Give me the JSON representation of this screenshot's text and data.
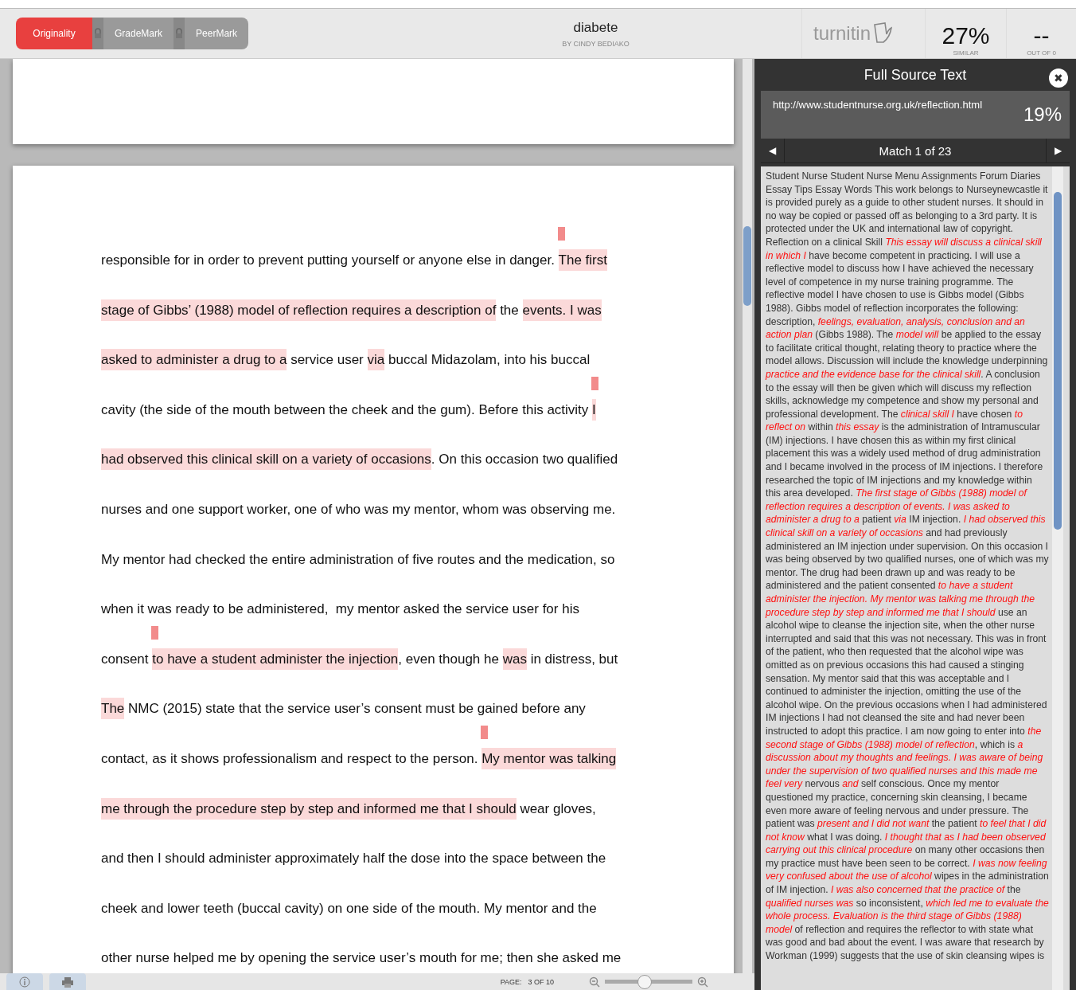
{
  "tabs": [
    {
      "label": "Originality",
      "selected": true,
      "locked": false
    },
    {
      "label": "GradeMark",
      "selected": false,
      "locked": true
    },
    {
      "label": "PeerMark",
      "selected": false,
      "locked": true
    }
  ],
  "document": {
    "title": "diabete",
    "author": "BY CINDY BEDIAKO"
  },
  "brand": "turnitin",
  "similarity": {
    "value": "27%",
    "label": "SIMILAR"
  },
  "grade": {
    "value": "--",
    "label": "OUT OF 0"
  },
  "essay_lines": [
    [
      {
        "text": "responsible for in order to prevent putting yourself or anyone else in danger. ",
        "match": false,
        "marker": false
      },
      {
        "text": "The first",
        "match": true,
        "marker": true
      }
    ],
    [
      {
        "text": "stage of Gibbs’ (1988) model of reflection requires a description of",
        "match": true,
        "marker": false
      },
      {
        "text": " the ",
        "match": false,
        "marker": false
      },
      {
        "text": "events. I was",
        "match": true,
        "marker": false
      }
    ],
    [
      {
        "text": "asked to administer a drug to a",
        "match": true,
        "marker": false
      },
      {
        "text": " service user ",
        "match": false,
        "marker": false
      },
      {
        "text": "via",
        "match": true,
        "marker": false
      },
      {
        "text": " buccal Midazolam, into his buccal",
        "match": false,
        "marker": false
      }
    ],
    [
      {
        "text": "cavity (the side of the mouth between the cheek and the gum). Before this activity ",
        "match": false,
        "marker": false
      },
      {
        "text": "I",
        "match": true,
        "marker": true
      }
    ],
    [
      {
        "text": "had observed this clinical skill on a variety of occasions",
        "match": true,
        "marker": false
      },
      {
        "text": ". On this occasion two qualified",
        "match": false,
        "marker": false
      }
    ],
    [
      {
        "text": "nurses and one support worker, one of who was my mentor, whom was observing me.",
        "match": false,
        "marker": false
      }
    ],
    [
      {
        "text": "My mentor had checked the entire administration of five routes and the medication, so",
        "match": false,
        "marker": false
      }
    ],
    [
      {
        "text": "when it was ready to be administered,  my mentor asked the service user for his",
        "match": false,
        "marker": false
      }
    ],
    [
      {
        "text": "consent ",
        "match": false,
        "marker": false
      },
      {
        "text": "to have a student administer the injection",
        "match": true,
        "marker": true
      },
      {
        "text": ", even though he ",
        "match": false,
        "marker": false
      },
      {
        "text": "was",
        "match": true,
        "marker": false
      },
      {
        "text": " in distress, but",
        "match": false,
        "marker": false
      }
    ],
    [
      {
        "text": "The",
        "match": true,
        "marker": false
      },
      {
        "text": " NMC (2015) state that the service user’s consent must be gained before any",
        "match": false,
        "marker": false
      }
    ],
    [
      {
        "text": "contact, as it shows professionalism and respect to the person. ",
        "match": false,
        "marker": false
      },
      {
        "text": "My mentor was talking",
        "match": true,
        "marker": true
      }
    ],
    [
      {
        "text": "me through the procedure step by step and informed me that I should",
        "match": true,
        "marker": false
      },
      {
        "text": " wear gloves,",
        "match": false,
        "marker": false
      }
    ],
    [
      {
        "text": "and then I should administer approximately half the dose into the space between the",
        "match": false,
        "marker": false
      }
    ],
    [
      {
        "text": "cheek and lower teeth (buccal cavity) on one side of the mouth. My mentor and the",
        "match": false,
        "marker": false
      }
    ],
    [
      {
        "text": "other nurse helped me by opening the service user’s mouth for me; then she asked me",
        "match": false,
        "marker": false
      }
    ]
  ],
  "source_panel": {
    "title": "Full Source Text",
    "close": "✖",
    "url": "http://www.studentnurse.org.uk/reflection.html",
    "percent": "19%",
    "prev": "◀",
    "match_label": "Match 1 of 23",
    "next": "▶",
    "segments": [
      {
        "text": "Student Nurse Student Nurse Menu Assignments Forum Diaries Essay Tips Essay Words This work belongs to Nurseynewcastle it is provided purely as a guide to other student nurses. It should in no way be copied or passed off as belonging to a 3rd party. It is protected under the UK and international law of copyright. Reflection on a clinical Skill ",
        "match": false
      },
      {
        "text": "This essay will discuss a clinical skill in which I",
        "match": true
      },
      {
        "text": " have become competent in practicing. I will use a reflective model to discuss how I have achieved the necessary level of competence in my nurse training programme. The reflective model I have chosen to use is Gibbs model (Gibbs 1988). Gibbs model of reflection incorporates the following: description, ",
        "match": false
      },
      {
        "text": "feelings, evaluation, analysis, conclusion and an action plan",
        "match": true
      },
      {
        "text": " (Gibbs 1988). The ",
        "match": false
      },
      {
        "text": "model will",
        "match": true
      },
      {
        "text": " be applied to the essay to facilitate critical thought, relating theory to practice where the model allows. Discussion will include the knowledge underpinning ",
        "match": false
      },
      {
        "text": "practice and the evidence base for the clinical skill",
        "match": true
      },
      {
        "text": ". A conclusion to the essay will then be given which will discuss my reflection skills, acknowledge my competence and show my personal and professional development. The ",
        "match": false
      },
      {
        "text": "clinical skill I",
        "match": true
      },
      {
        "text": " have chosen ",
        "match": false
      },
      {
        "text": "to reflect on",
        "match": true
      },
      {
        "text": " within ",
        "match": false
      },
      {
        "text": "this essay",
        "match": true
      },
      {
        "text": " is the administration of Intramuscular (IM) injections. I have chosen this as within my first clinical placement this was a widely used method of drug administration and I became involved in the process of IM injections. I therefore researched the topic of IM injections and my knowledge within this area developed. ",
        "match": false
      },
      {
        "text": "The first stage of Gibbs (1988) model of reflection requires a description of events. I was asked to administer a drug to a",
        "match": true
      },
      {
        "text": " patient ",
        "match": false
      },
      {
        "text": "via",
        "match": true
      },
      {
        "text": " IM injection. ",
        "match": false
      },
      {
        "text": "I had observed this clinical skill on a variety of occasions",
        "match": true
      },
      {
        "text": " and had previously administered an IM injection under supervision. On this occasion I was being observed by two qualified nurses, one of which was my mentor. The drug had been drawn up and was ready to be administered and the patient consented ",
        "match": false
      },
      {
        "text": "to have a student administer the injection. My mentor was talking me through the procedure step by step and informed me that I should",
        "match": true
      },
      {
        "text": " use an alcohol wipe to cleanse the injection site, when the other nurse interrupted and said that this was not necessary. This was in front of the patient, who then requested that the alcohol wipe was omitted as on previous occasions this had caused a stinging sensation. My mentor said that this was acceptable and I continued to administer the injection, omitting the use of the alcohol wipe. On the previous occasions when I had administered IM injections I had not cleansed the site and had never been instructed to adopt this practice. I am now going to enter into ",
        "match": false
      },
      {
        "text": "the second stage of Gibbs (1988) model of reflection",
        "match": true
      },
      {
        "text": ", which is ",
        "match": false
      },
      {
        "text": "a discussion about my thoughts and feelings. I was aware of being under the supervision of two qualified nurses and this made me feel very",
        "match": true
      },
      {
        "text": " nervous ",
        "match": false
      },
      {
        "text": "and",
        "match": true
      },
      {
        "text": " self conscious. Once my mentor questioned my practice, concerning skin cleansing, I became even more aware of feeling nervous and under pressure. The patient was ",
        "match": false
      },
      {
        "text": "present and I did not want",
        "match": true
      },
      {
        "text": " the patient ",
        "match": false
      },
      {
        "text": "to feel that I did not know",
        "match": true
      },
      {
        "text": " what I was doing. ",
        "match": false
      },
      {
        "text": "I thought that as I had been observed carrying out this clinical procedure",
        "match": true
      },
      {
        "text": " on many other occasions then my practice must have been seen to be correct. ",
        "match": false
      },
      {
        "text": "I was now feeling very confused about the use of alcohol",
        "match": true
      },
      {
        "text": " wipes in the administration of IM injection. ",
        "match": false
      },
      {
        "text": "I was also concerned that the practice of",
        "match": true
      },
      {
        "text": " the ",
        "match": false
      },
      {
        "text": "qualified nurses was",
        "match": true
      },
      {
        "text": " so inconsistent, ",
        "match": false
      },
      {
        "text": "which led me to evaluate the whole process. Evaluation is the third stage of Gibbs (1988) model",
        "match": true
      },
      {
        "text": " of reflection and requires the reflector to with state what was good and bad about the event. I was aware that research by Workman (1999) suggests that the use of skin cleansing wipes is",
        "match": false
      }
    ]
  },
  "footer": {
    "page_label": "PAGE:",
    "page_value": "3 OF 10",
    "zoom": {
      "level": 0.45
    }
  }
}
